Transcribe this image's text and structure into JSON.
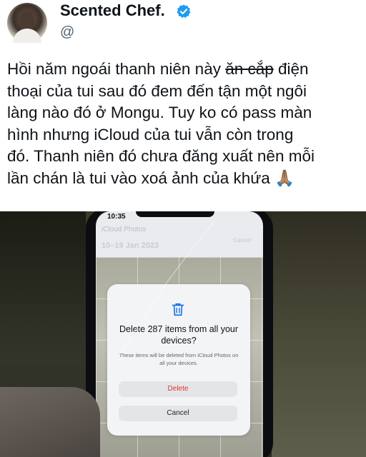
{
  "post": {
    "author_name": "Scented Chef.",
    "handle": "@",
    "text_lines": [
      {
        "before": "Hồi năm ngoái thanh niên này ",
        "strike": "ăn cắp",
        "after": " điện"
      },
      {
        "text": "thoại của tui sau đó đem đến tận một ngôi"
      },
      {
        "text": "làng nào đó ở Mongu. Tuy ko có pass màn"
      },
      {
        "text": "hình nhưng iCloud của tui vẫn còn trong"
      },
      {
        "text": "đó. Thanh niên đó chưa đăng xuất nên mỗi"
      },
      {
        "text": "lần chán là tui vào xoá ảnh của khứa 🙏🏽"
      }
    ]
  },
  "photo": {
    "status_time": "10:35",
    "app_title": "iCloud Photos",
    "date_range": "10–19 Jan 2023",
    "cancel_top": "Cancel",
    "dialog": {
      "title": "Delete 287 items from all your devices?",
      "description": "These items will be deleted from iCloud Photos on all your devices.",
      "delete_label": "Delete",
      "cancel_label": "Cancel"
    }
  },
  "colors": {
    "verified_badge": "#1d9bf0",
    "delete_text": "#e0362f",
    "trash_icon": "#1a73e8"
  }
}
